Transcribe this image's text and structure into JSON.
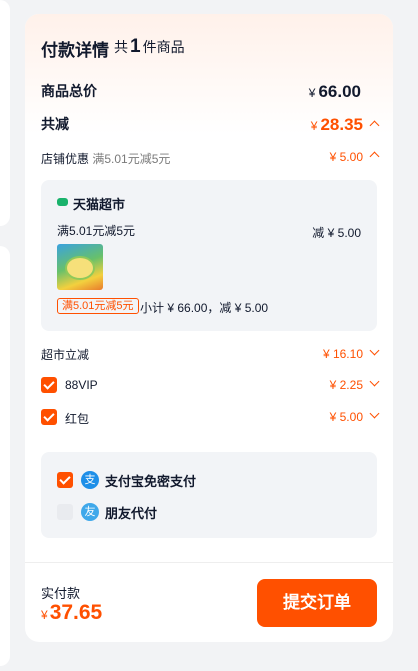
{
  "colors": {
    "accent": "#ff5000",
    "background": "#f2f3f5"
  },
  "header": {
    "title": "付款详情",
    "count_prefix": "共",
    "count": "1",
    "count_suffix": "件商品"
  },
  "total": {
    "label": "商品总价",
    "currency": "¥",
    "amount": "66.00"
  },
  "discount": {
    "label": "共减",
    "currency": "¥",
    "amount": "28.35"
  },
  "store_discount": {
    "label": "店铺优惠",
    "detail": "满5.01元减5元",
    "value": "¥ 5.00"
  },
  "store": {
    "icon": "tmall-cat-icon",
    "name": "天猫超市",
    "promo": "满5.01元减5元",
    "promo_value": "减 ¥ 5.00",
    "tag": "满5.01元减5元",
    "subtotal": "小计 ¥ 66.00，减 ¥ 5.00"
  },
  "market_discount": {
    "label": "超市立减",
    "value": "¥ 16.10"
  },
  "options": [
    {
      "label": "88VIP",
      "value": "¥ 2.25",
      "checked": true
    },
    {
      "label": "红包",
      "value": "¥ 5.00",
      "checked": true
    }
  ],
  "payment": [
    {
      "label": "支付宝免密支付",
      "icon": "alipay-icon",
      "checked": true
    },
    {
      "label": "朋友代付",
      "icon": "friend-pay-icon",
      "checked": false
    }
  ],
  "footer": {
    "paid_label": "实付款",
    "currency": "¥",
    "paid_amount": "37.65",
    "submit_label": "提交订单"
  }
}
